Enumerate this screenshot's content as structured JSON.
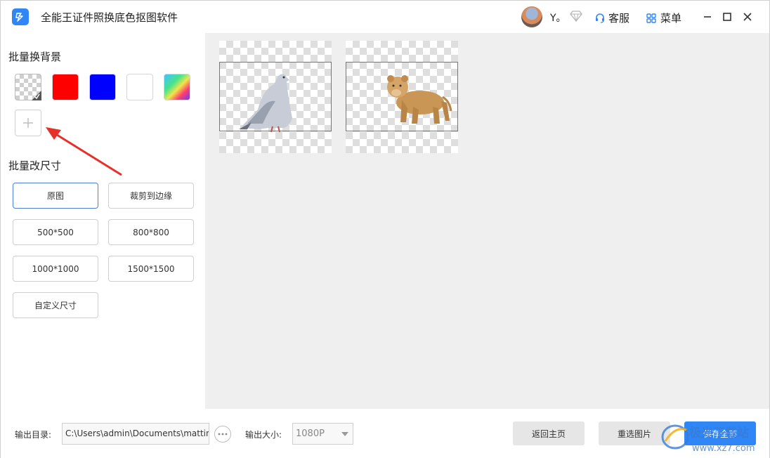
{
  "app": {
    "title": "全能王证件照换底色抠图软件",
    "username": "Y。",
    "service_label": "客服",
    "menu_label": "菜单"
  },
  "left": {
    "bg_section_title": "批量换背景",
    "bg_swatches": [
      {
        "name": "transparent",
        "color": "transparent"
      },
      {
        "name": "red",
        "color": "#ff0000"
      },
      {
        "name": "blue",
        "color": "#0000ff"
      },
      {
        "name": "white",
        "color": "#ffffff"
      },
      {
        "name": "gradient",
        "color": "gradient"
      }
    ],
    "size_section_title": "批量改尺寸",
    "size_buttons": [
      "原图",
      "裁剪到边缘",
      "500*500",
      "800*800",
      "1000*1000",
      "1500*1500",
      "自定义尺寸"
    ],
    "selected_size": "原图"
  },
  "preview": {
    "images": [
      {
        "subject": "pigeon"
      },
      {
        "subject": "lion-cub"
      }
    ]
  },
  "bottom": {
    "output_dir_label": "输出目录:",
    "output_dir_value": "C:\\Users\\admin\\Documents\\matting",
    "output_size_label": "输出大小:",
    "output_size_value": "1080P",
    "home_button": "返回主页",
    "reselect_button": "重选图片",
    "save_all_button": "保存全部"
  },
  "colors": {
    "accent": "#2f86f6",
    "annotation_arrow": "#e8302a",
    "preview_bg": "#efefef"
  },
  "watermark": {
    "text": "极光下载站",
    "url": "www.xz7.com"
  }
}
